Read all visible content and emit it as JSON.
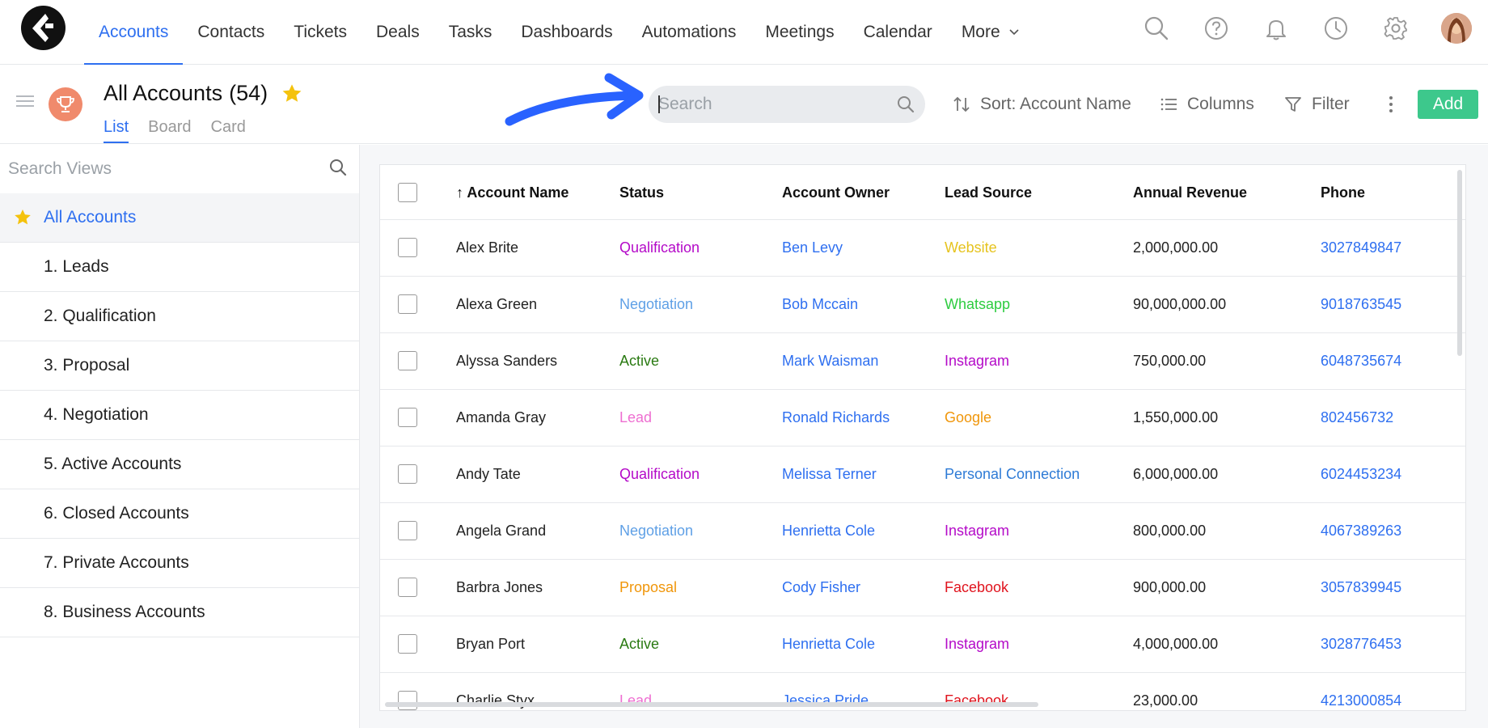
{
  "nav": {
    "tabs": [
      {
        "label": "Accounts"
      },
      {
        "label": "Contacts"
      },
      {
        "label": "Tickets"
      },
      {
        "label": "Deals"
      },
      {
        "label": "Tasks"
      },
      {
        "label": "Dashboards"
      },
      {
        "label": "Automations"
      },
      {
        "label": "Meetings"
      },
      {
        "label": "Calendar"
      },
      {
        "label": "More"
      }
    ],
    "active_tab": "Accounts",
    "icons": [
      "search-icon",
      "help-icon",
      "bell-icon",
      "clock-icon",
      "gear-icon"
    ]
  },
  "header": {
    "title": "All Accounts",
    "count": "(54)",
    "view_tabs": [
      {
        "label": "List"
      },
      {
        "label": "Board"
      },
      {
        "label": "Card"
      }
    ],
    "active_view": "List",
    "search_placeholder": "Search",
    "sort_label": "Sort: Account Name",
    "columns_label": "Columns",
    "filter_label": "Filter",
    "add_label": "Add"
  },
  "sidebar": {
    "search_placeholder": "Search Views",
    "items": [
      {
        "label": "All Accounts"
      },
      {
        "label": "1. Leads"
      },
      {
        "label": "2. Qualification"
      },
      {
        "label": "3. Proposal"
      },
      {
        "label": "4. Negotiation"
      },
      {
        "label": "5. Active Accounts"
      },
      {
        "label": "6. Closed Accounts"
      },
      {
        "label": "7. Private Accounts"
      },
      {
        "label": "8. Business Accounts"
      }
    ]
  },
  "table": {
    "columns": [
      "Account Name",
      "Status",
      "Account Owner",
      "Lead Source",
      "Annual Revenue",
      "Phone"
    ],
    "sort_arrow": "↑",
    "rows": [
      {
        "name": "Alex Brite",
        "status": "Qualification",
        "owner": "Ben Levy",
        "source": "Website",
        "revenue": "2,000,000.00",
        "phone": "3027849847"
      },
      {
        "name": "Alexa Green",
        "status": "Negotiation",
        "owner": "Bob Mccain",
        "source": "Whatsapp",
        "revenue": "90,000,000.00",
        "phone": "9018763545"
      },
      {
        "name": "Alyssa Sanders",
        "status": "Active",
        "owner": "Mark Waisman",
        "source": "Instagram",
        "revenue": "750,000.00",
        "phone": "6048735674"
      },
      {
        "name": "Amanda Gray",
        "status": "Lead",
        "owner": "Ronald Richards",
        "source": "Google",
        "revenue": "1,550,000.00",
        "phone": "802456732"
      },
      {
        "name": "Andy Tate",
        "status": "Qualification",
        "owner": "Melissa Terner",
        "source": "Personal Connection",
        "revenue": "6,000,000.00",
        "phone": "6024453234"
      },
      {
        "name": "Angela Grand",
        "status": "Negotiation",
        "owner": "Henrietta Cole",
        "source": "Instagram",
        "revenue": "800,000.00",
        "phone": "4067389263"
      },
      {
        "name": "Barbra Jones",
        "status": "Proposal",
        "owner": "Cody Fisher",
        "source": "Facebook",
        "revenue": "900,000.00",
        "phone": "3057839945"
      },
      {
        "name": "Bryan Port",
        "status": "Active",
        "owner": "Henrietta Cole",
        "source": "Instagram",
        "revenue": "4,000,000.00",
        "phone": "3028776453"
      },
      {
        "name": "Charlie Styx",
        "status": "Lead",
        "owner": "Jessica Pride",
        "source": "Facebook",
        "revenue": "23,000.00",
        "phone": "4213000854"
      }
    ]
  },
  "colors": {
    "accent": "#2e6ff0",
    "add_button": "#3dc88c",
    "status": {
      "Qualification": "#b40ac8",
      "Negotiation": "#5fa0e6",
      "Active": "#2a7a12",
      "Lead": "#ee6fd1",
      "Proposal": "#f0960a"
    },
    "source": {
      "Website": "#e6c31e",
      "Whatsapp": "#2ecc40",
      "Instagram": "#b40ac8",
      "Google": "#f0960a",
      "Personal Connection": "#2e7bd6",
      "Facebook": "#e0141e"
    }
  }
}
